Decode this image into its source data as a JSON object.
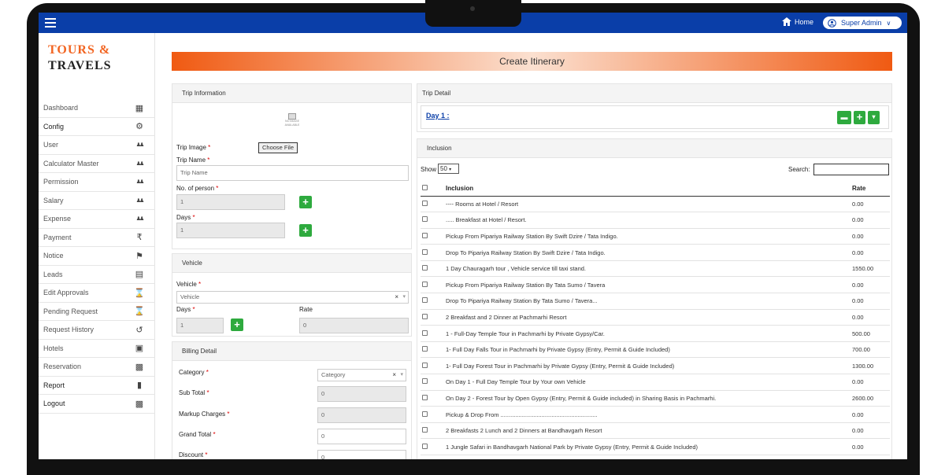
{
  "topbar": {
    "home_label": "Home",
    "user_label": "Super Admin"
  },
  "logo": {
    "line1": "TOURS &",
    "line2": "TRAVELS"
  },
  "sidebar": {
    "items": [
      {
        "label": "Dashboard",
        "icon": "dashboard-icon"
      },
      {
        "label": "Config",
        "icon": "gear-icon"
      },
      {
        "label": "User",
        "icon": "users-icon"
      },
      {
        "label": "Calculator Master",
        "icon": "users-icon"
      },
      {
        "label": "Permission",
        "icon": "users-icon"
      },
      {
        "label": "Salary",
        "icon": "users-icon"
      },
      {
        "label": "Expense",
        "icon": "users-icon"
      },
      {
        "label": "Payment",
        "icon": "rupee-icon"
      },
      {
        "label": "Notice",
        "icon": "bell-icon"
      },
      {
        "label": "Leads",
        "icon": "card-icon"
      },
      {
        "label": "Edit Approvals",
        "icon": "hourglass-icon"
      },
      {
        "label": "Pending Request",
        "icon": "hourglass-icon"
      },
      {
        "label": "Request History",
        "icon": "history-icon"
      },
      {
        "label": "Hotels",
        "icon": "building-icon"
      },
      {
        "label": "Reservation",
        "icon": "reservation-icon"
      },
      {
        "label": "Report",
        "icon": "bar-chart-icon"
      },
      {
        "label": "Logout",
        "icon": "lock-icon"
      }
    ]
  },
  "page": {
    "title": "Create Itinerary"
  },
  "trip_info": {
    "header": "Trip Information",
    "no_image_text": "NO IMAGE AVAILABLE",
    "trip_image_label": "Trip Image",
    "choose_file": "Choose File",
    "trip_name_label": "Trip Name",
    "trip_name_placeholder": "Trip Name",
    "persons_label": "No. of person",
    "persons_value": "1",
    "days_label": "Days",
    "days_value": "1"
  },
  "vehicle": {
    "header": "Vehicle",
    "vehicle_label": "Vehicle",
    "vehicle_value": "Vehicle",
    "days_label": "Days",
    "days_value": "1",
    "rate_label": "Rate",
    "rate_value": "0"
  },
  "billing": {
    "header": "Billing Detail",
    "category_label": "Category",
    "category_value": "Category",
    "subtotal_label": "Sub Total",
    "subtotal_value": "0",
    "markup_label": "Markup Charges",
    "markup_value": "0",
    "grand_label": "Grand Total",
    "grand_value": "0",
    "discount_label": "Discount",
    "discount_value": "0"
  },
  "trip_detail": {
    "header": "Trip Detail",
    "day_label": "Day 1 :"
  },
  "inclusion": {
    "header": "Inclusion",
    "show_label": "Show",
    "show_value": "50",
    "search_label": "Search:",
    "col_inclusion": "Inclusion",
    "col_rate": "Rate",
    "rows": [
      {
        "name": "---- Rooms at Hotel / Resort",
        "rate": "0.00"
      },
      {
        "name": "..... Breakfast at Hotel / Resort.",
        "rate": "0.00"
      },
      {
        "name": "Pickup From Pipariya Railway Station By Swift Dzire / Tata Indigo.",
        "rate": "0.00"
      },
      {
        "name": "Drop To Pipariya Railway Station By Swift Dzire / Tata Indigo.",
        "rate": "0.00"
      },
      {
        "name": "1 Day Chauragarh tour , Vehicle service till taxi stand.",
        "rate": "1550.00"
      },
      {
        "name": "Pickup From Pipariya Railway Station By Tata Sumo / Tavera",
        "rate": "0.00"
      },
      {
        "name": "Drop To Pipariya Railway Station By Tata Sumo / Tavera...",
        "rate": "0.00"
      },
      {
        "name": "2 Breakfast and 2 Dinner at Pachmarhi Resort",
        "rate": "0.00"
      },
      {
        "name": "1 - Full-Day Temple Tour in Pachmarhi by Private Gypsy/Car.",
        "rate": "500.00"
      },
      {
        "name": "1- Full Day Falls Tour in Pachmarhi by Private Gypsy (Entry, Permit & Guide Included)",
        "rate": "700.00"
      },
      {
        "name": "1- Full Day Forest Tour in Pachmarhi by Private Gypsy (Entry, Permit & Guide Included)",
        "rate": "1300.00"
      },
      {
        "name": "On Day 1 - Full Day Temple Tour by Your own Vehicle",
        "rate": "0.00"
      },
      {
        "name": "On Day 2 - Forest Tour by Open Gypsy (Entry, Permit & Guide included) in Sharing Basis in Pachmarhi.",
        "rate": "2600.00"
      },
      {
        "name": "Pickup & Drop From ...........................................................",
        "rate": "0.00"
      },
      {
        "name": "2 Breakfasts 2 Lunch and 2 Dinners at Bandhavgarh Resort",
        "rate": "0.00"
      },
      {
        "name": "1 Jungle Safari in Bandhavgarh National Park by Private Gypsy (Entry, Permit & Guide Included)",
        "rate": "0.00"
      },
      {
        "name": "",
        "rate": ""
      }
    ]
  },
  "colors": {
    "topbar": "#0a3ea8",
    "accent": "#f26522",
    "button_green": "#2eaa3e"
  }
}
